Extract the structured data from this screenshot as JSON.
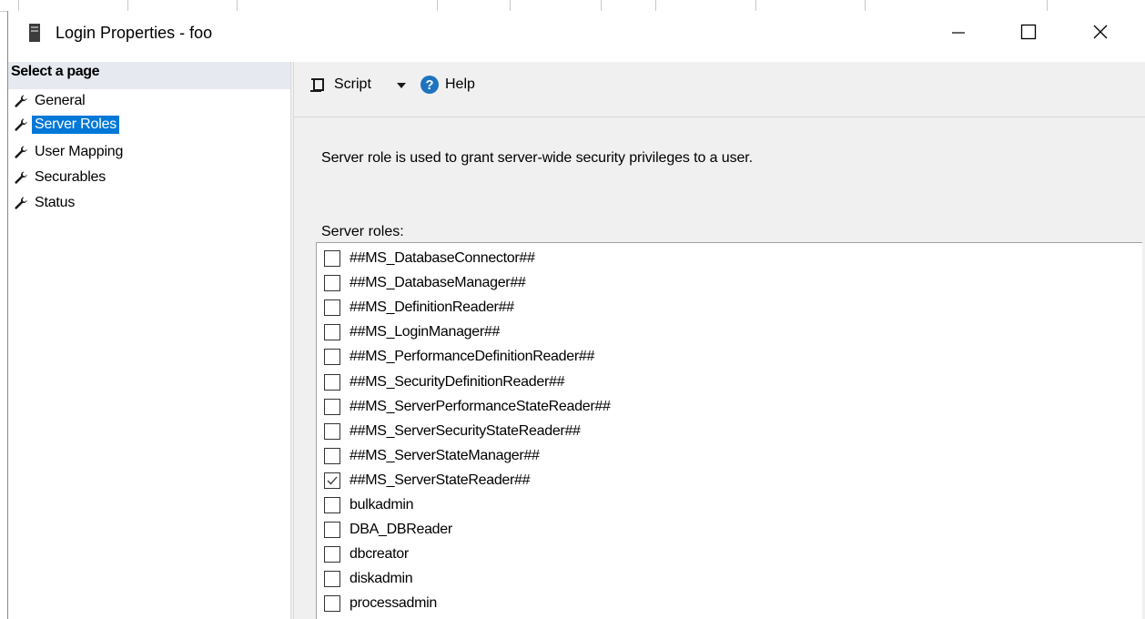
{
  "window": {
    "title": "Login Properties - foo"
  },
  "sidebar": {
    "header": "Select a page",
    "items": [
      {
        "label": "General"
      },
      {
        "label": "Server Roles",
        "selected": true
      },
      {
        "label": "User Mapping"
      },
      {
        "label": "Securables"
      },
      {
        "label": "Status"
      }
    ]
  },
  "toolbar": {
    "script_label": "Script",
    "help_label": "Help"
  },
  "main": {
    "description": "Server role is used to grant server-wide security privileges to a user.",
    "roles_label": "Server roles:",
    "roles": [
      {
        "name": "##MS_DatabaseConnector##",
        "checked": false
      },
      {
        "name": "##MS_DatabaseManager##",
        "checked": false
      },
      {
        "name": "##MS_DefinitionReader##",
        "checked": false
      },
      {
        "name": "##MS_LoginManager##",
        "checked": false
      },
      {
        "name": "##MS_PerformanceDefinitionReader##",
        "checked": false
      },
      {
        "name": "##MS_SecurityDefinitionReader##",
        "checked": false
      },
      {
        "name": "##MS_ServerPerformanceStateReader##",
        "checked": false
      },
      {
        "name": "##MS_ServerSecurityStateReader##",
        "checked": false
      },
      {
        "name": "##MS_ServerStateManager##",
        "checked": false
      },
      {
        "name": "##MS_ServerStateReader##",
        "checked": true
      },
      {
        "name": "bulkadmin",
        "checked": false
      },
      {
        "name": "DBA_DBReader",
        "checked": false
      },
      {
        "name": "dbcreator",
        "checked": false
      },
      {
        "name": "diskadmin",
        "checked": false
      },
      {
        "name": "processadmin",
        "checked": false
      }
    ]
  },
  "colors": {
    "selection": "#0078d7",
    "panel_bg": "#f0f0f0",
    "sidebar_header_bg": "#e6eaf0",
    "help_icon": "#1e73be"
  },
  "icons": {
    "app": "server-icon",
    "nav": "wrench-icon",
    "script": "script-icon",
    "dropdown": "dropdown-arrow-icon",
    "help": "help-icon",
    "minimize": "minimize-icon",
    "maximize": "maximize-icon",
    "close": "close-icon"
  }
}
